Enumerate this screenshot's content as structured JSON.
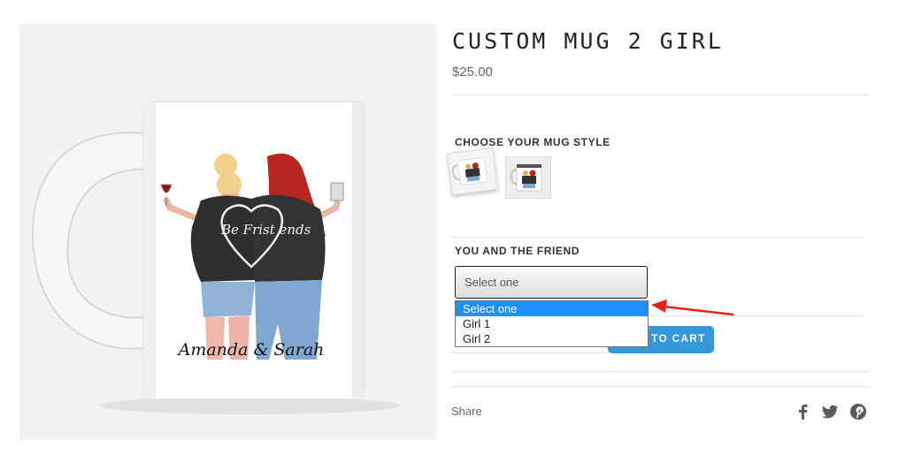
{
  "product": {
    "title": "CUSTOM MUG 2 GIRL",
    "price": "$25.00",
    "image": {
      "caption": "Amanda & Sarah",
      "jacket_left": "Be Fri",
      "jacket_right": "st ends"
    }
  },
  "mug_style": {
    "label": "CHOOSE YOUR MUG STYLE",
    "thumbnails": [
      "mug-style-1",
      "mug-style-2"
    ]
  },
  "friend": {
    "label": "YOU AND THE FRIEND",
    "select_value": "Select one",
    "options": [
      "Select one",
      "Girl 1",
      "Girl 2"
    ],
    "highlighted": "Select one"
  },
  "cart": {
    "button_label": "TO CART"
  },
  "share": {
    "label": "Share",
    "icons": [
      "facebook-icon",
      "twitter-icon",
      "pinterest-icon"
    ]
  },
  "colors": {
    "accent": "#3498db",
    "dropdown_highlight": "#1e90ff",
    "annotation_arrow": "#e0211a"
  }
}
